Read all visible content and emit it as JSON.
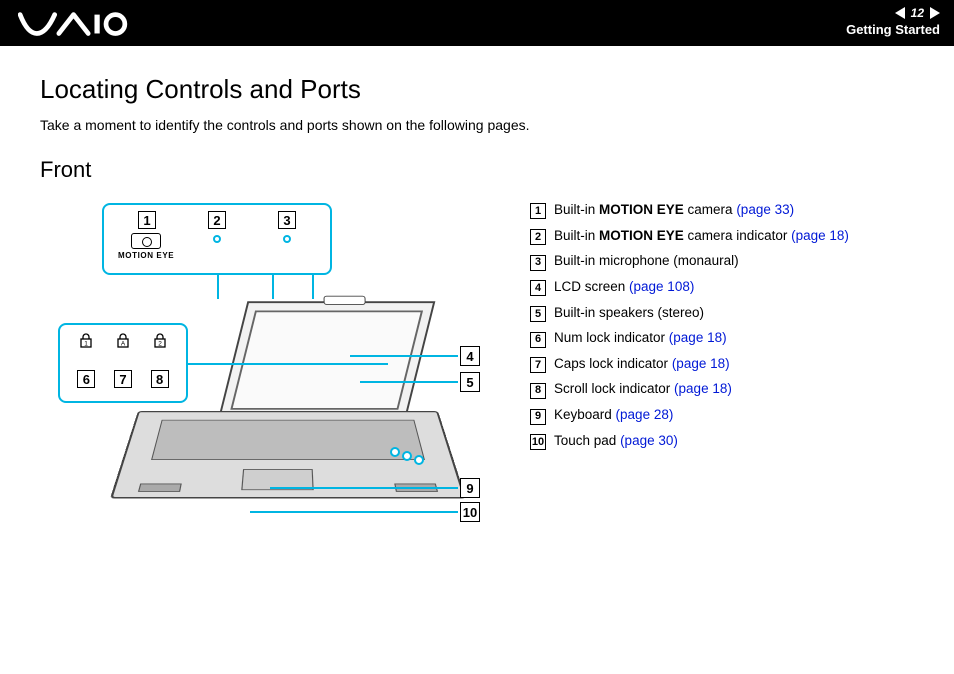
{
  "header": {
    "page_number": "12",
    "section": "Getting Started"
  },
  "title": "Locating Controls and Ports",
  "intro": "Take a moment to identify the controls and ports shown on the following pages.",
  "subtitle": "Front",
  "diagram": {
    "motion_eye_label": "MOTION EYE",
    "top_nums": [
      "1",
      "2",
      "3"
    ],
    "left_lock_labels": [
      "1",
      "A",
      "2"
    ],
    "left_nums": [
      "6",
      "7",
      "8"
    ],
    "side_labels": {
      "a": "4",
      "b": "5",
      "c": "9",
      "d": "10"
    }
  },
  "legend": [
    {
      "n": "1",
      "pre": "Built-in ",
      "bold": "MOTION EYE",
      "post": " camera ",
      "ref": "(page 33)"
    },
    {
      "n": "2",
      "pre": "Built-in ",
      "bold": "MOTION EYE",
      "post": " camera indicator ",
      "ref": "(page 18)"
    },
    {
      "n": "3",
      "pre": "Built-in microphone (monaural)",
      "bold": "",
      "post": "",
      "ref": ""
    },
    {
      "n": "4",
      "pre": "LCD screen ",
      "bold": "",
      "post": "",
      "ref": "(page 108)"
    },
    {
      "n": "5",
      "pre": "Built-in speakers (stereo)",
      "bold": "",
      "post": "",
      "ref": ""
    },
    {
      "n": "6",
      "pre": "Num lock indicator ",
      "bold": "",
      "post": "",
      "ref": "(page 18)"
    },
    {
      "n": "7",
      "pre": "Caps lock indicator ",
      "bold": "",
      "post": "",
      "ref": "(page 18)"
    },
    {
      "n": "8",
      "pre": "Scroll lock indicator ",
      "bold": "",
      "post": "",
      "ref": "(page 18)"
    },
    {
      "n": "9",
      "pre": "Keyboard ",
      "bold": "",
      "post": "",
      "ref": "(page 28)"
    },
    {
      "n": "10",
      "pre": "Touch pad ",
      "bold": "",
      "post": "",
      "ref": "(page 30)"
    }
  ]
}
